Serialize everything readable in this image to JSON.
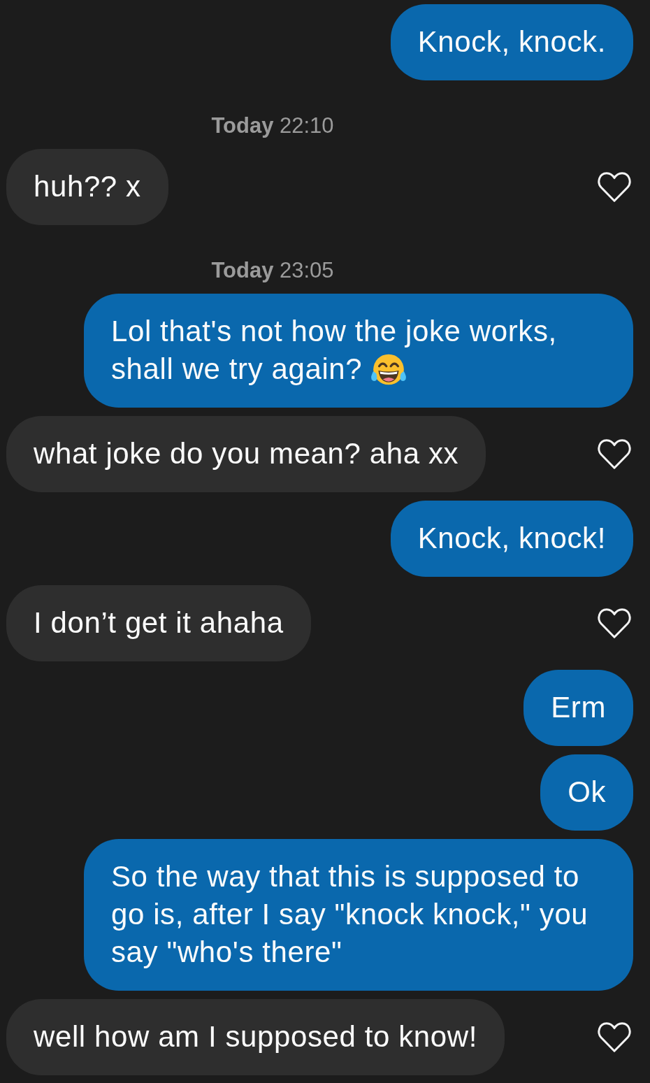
{
  "conversation": [
    {
      "kind": "message",
      "outgoing": true,
      "text": "Knock, knock.",
      "emoji": false
    },
    {
      "kind": "timestamp",
      "text": "**Today** 22:10"
    },
    {
      "kind": "message",
      "outgoing": false,
      "text": "huh?? x",
      "emoji": false,
      "liked": false
    },
    {
      "kind": "timestamp",
      "text": "**Today** 23:05"
    },
    {
      "kind": "message",
      "outgoing": true,
      "text": "Lol that's not how the joke works, shall we try again?",
      "emoji": true
    },
    {
      "kind": "message",
      "outgoing": false,
      "text": "what joke do you mean? aha xx",
      "emoji": false,
      "liked": false
    },
    {
      "kind": "message",
      "outgoing": true,
      "text": "Knock, knock!",
      "emoji": false
    },
    {
      "kind": "message",
      "outgoing": false,
      "text": "I don’t get it ahaha",
      "emoji": false,
      "liked": false
    },
    {
      "kind": "message",
      "outgoing": true,
      "text": "Erm",
      "emoji": false
    },
    {
      "kind": "message",
      "outgoing": true,
      "text": "Ok",
      "emoji": false
    },
    {
      "kind": "message",
      "outgoing": true,
      "text": "So the way that this is supposed to go is, after I say \"knock knock,\" you say \"who's there\"",
      "emoji": false
    },
    {
      "kind": "message",
      "outgoing": false,
      "text": "well how am I supposed to know!",
      "emoji": false,
      "liked": false
    }
  ]
}
